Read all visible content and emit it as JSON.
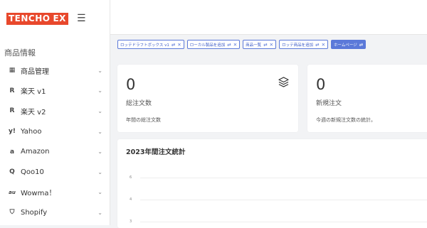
{
  "logo": {
    "part_a": "TENCHO",
    "part_b": "EX"
  },
  "sidebar": {
    "section_title": "商品情報",
    "items": [
      {
        "label": "商品管理",
        "icon": "grid-icon",
        "glyph": "▦"
      },
      {
        "label": "楽天 v1",
        "icon": "rakuten-icon",
        "glyph": "R"
      },
      {
        "label": "楽天 v2",
        "icon": "rakuten-icon",
        "glyph": "R"
      },
      {
        "label": "Yahoo",
        "icon": "yahoo-icon",
        "glyph": "Y"
      },
      {
        "label": "Amazon",
        "icon": "amazon-icon",
        "glyph": "a"
      },
      {
        "label": "Qoo10",
        "icon": "qoo10-icon",
        "glyph": "Q"
      },
      {
        "label": "Wowma！",
        "icon": "wowma-icon",
        "glyph": "au"
      },
      {
        "label": "Shopify",
        "icon": "shopify-icon",
        "glyph": "S"
      }
    ]
  },
  "tabs": [
    {
      "label": "ロッテドラフトボックス v1"
    },
    {
      "label": "ローカル製品を追加"
    },
    {
      "label": "商品一覧"
    },
    {
      "label": "ロッテ商品を追加"
    },
    {
      "label": "ホームページ"
    }
  ],
  "cards": {
    "total": {
      "value": "0",
      "title": "総注文数",
      "sub": "年間の総注文数"
    },
    "new": {
      "value": "0",
      "title": "新規注文",
      "sub": "今週の新規注文数の統計。"
    }
  },
  "chart": {
    "title": "2023年間注文統計",
    "ticks": [
      "6",
      "4",
      "3"
    ]
  },
  "colors": {
    "brand": "#e8482c",
    "accent": "#5b79d9"
  }
}
